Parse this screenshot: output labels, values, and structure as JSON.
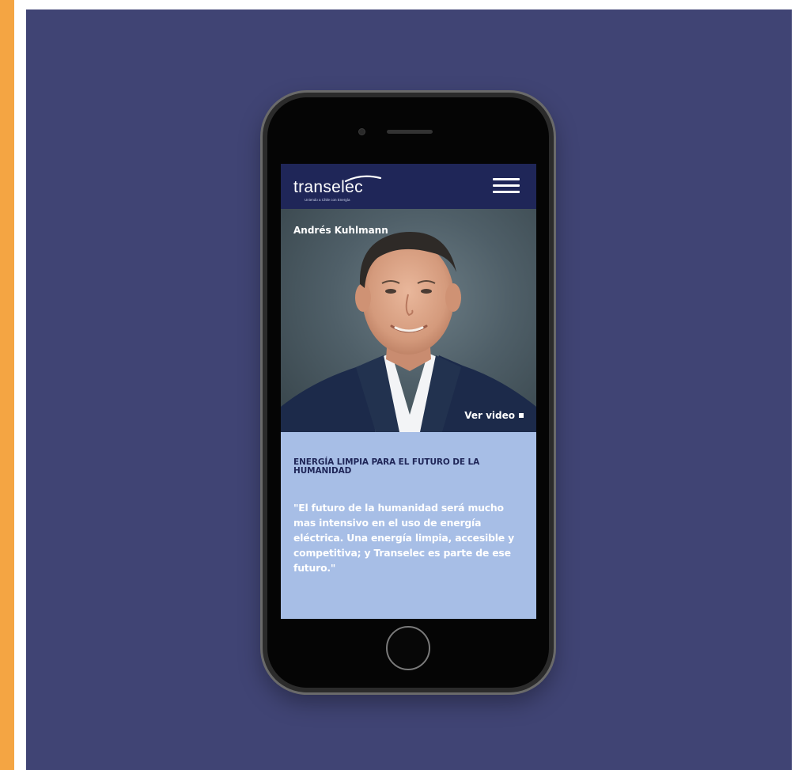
{
  "brand": {
    "logo_text": "transelec",
    "tagline": "Uniendo a Chile con Energía"
  },
  "hero": {
    "name": "Andrés Kuhlmann",
    "video_label": "Ver video"
  },
  "content": {
    "headline": "ENERGÍA LIMPIA PARA EL FUTURO DE LA HUMANIDAD",
    "quote": "\"El futuro de la humanidad será mucho mas intensivo en el uso de energía eléctrica. Una energía limpia, accesible y competitiva; y Transelec es parte de ese futuro.\""
  },
  "colors": {
    "orange_strip": "#f4a543",
    "backdrop": "#404474",
    "topbar": "#1f2658",
    "content_bg": "#a7bee6",
    "headline": "#1f2658"
  },
  "icons": {
    "menu": "hamburger-menu-icon",
    "video": "square-stop-icon"
  }
}
